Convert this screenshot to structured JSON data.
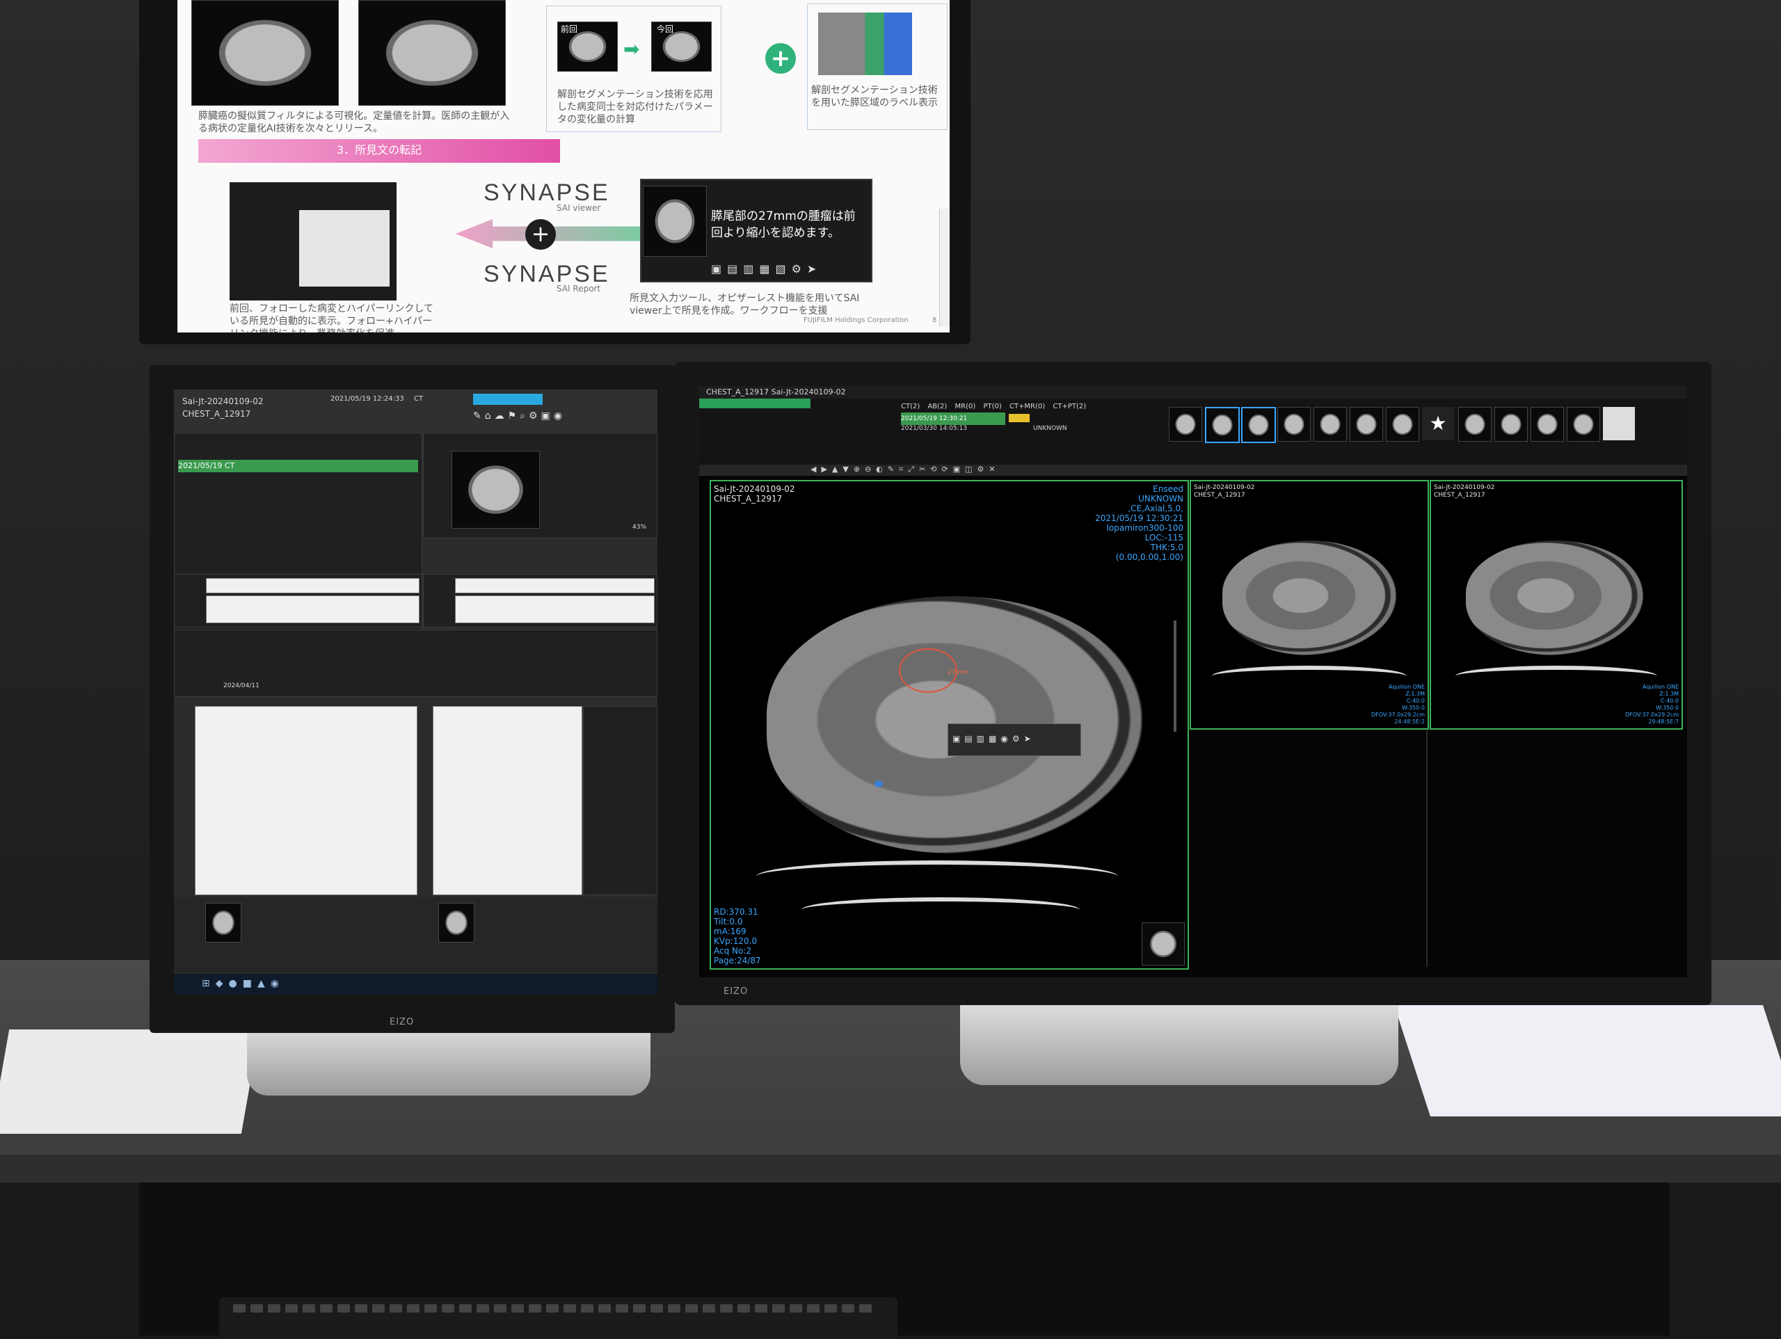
{
  "top_slide": {
    "caption_left": "膵臓癌の擬似質フィルタによる可視化。定量値を計算。医師の主観が入る病状の定量化AI技術を次々とリリース。",
    "step_label": "3．所見文の転記",
    "prev_label": "前回",
    "curr_label": "今回",
    "seg_text_1": "解剖セグメンテーション技術を応用した病変同士を対応付けたパラメータの変化量の計算",
    "seg_text_2": "解剖セグメンテーション技術を用いた膵区域のラベル表示",
    "logo_viewer": "SYNAPSE",
    "logo_viewer_sub": "SAI viewer",
    "logo_report": "SYNAPSE",
    "logo_report_sub": "SAI Report",
    "popup_finding": "膵尾部の27mmの腫瘤は前回より縮小を認めます。",
    "bottom_left_text": "前回、フォローした病変とハイパーリンクしている所見が自動的に表示。フォロー+ハイパーリンク機能により、業務効率化を促進",
    "bottom_right_text": "所見文入力ツール、オピザーレスト機能を用いてSAI viewer上で所見を作成。ワークフローを支援",
    "corp": "FUJIFILM Holdings Corporation",
    "page_no": "8"
  },
  "left_monitor": {
    "patient_id": "Sai-Jt-20240109-02",
    "patient_name": "CHEST_A_12917",
    "exam_datetime": "2021/05/19 12:24:33",
    "modality": "CT",
    "highlight_row": "2021/05/19   CT",
    "zoom": "43%",
    "exam_date_2": "2024/04/11",
    "brand": "EIZO"
  },
  "right_monitor": {
    "title_bar": "CHEST_A_12917  Sai-Jt-20240109-02",
    "series_tabs": [
      "CT(2)",
      "AB(2)",
      "MR(0)",
      "PT(0)",
      "CT+MR(0)",
      "CT+PT(2)"
    ],
    "study_rows": [
      "2021/05/19 12:30:21",
      "2021/03/30 14:05:13"
    ],
    "unknown": "UNKNOWN",
    "main_vp": {
      "top_left": "Sai-Jt-20240109-02\nCHEST_A_12917",
      "top_right": "Enseed\nUNKNOWN\n,CE,Axial,5.0,\n2021/05/19 12:30:21\nIopamiron300-100\nLOC:-115\nTHK:5.0\n(0.00,0.00,1.00)",
      "bottom_left": "RD:370.31\nTilt:0.0\nmA:169\nKVp:120.0\nAcq No:2\nPage:24/87"
    },
    "side_vp_1": {
      "top_left": "Sai-Jt-20240109-02\nCHEST_A_12917",
      "bottom_right": "Aquilion ONE\nZ:1.3M\nC:40.0\nW:350.0\nDFOV:37.0x29.2cm\n24:48:5E:2"
    },
    "side_vp_2": {
      "top_left": "Sai-Jt-20240109-02\nCHEST_A_12917",
      "bottom_right": "Aquilion ONE\nZ:1.3M\nC:40.0\nW:350.0\nDFOV:37.0x29.2cm\n29:48:5E:7"
    },
    "brand": "EIZO"
  }
}
